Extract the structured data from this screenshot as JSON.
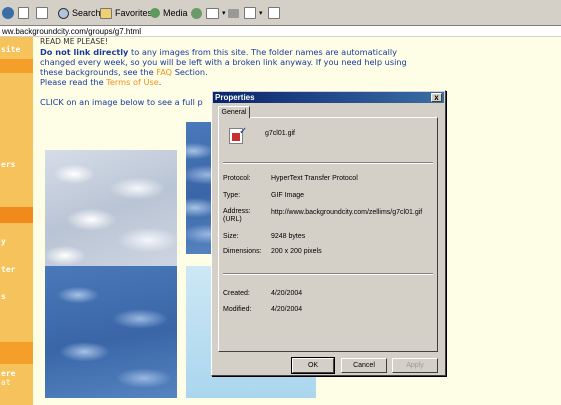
{
  "toolbar": {
    "search_label": "Search",
    "favorites_label": "Favorites",
    "media_label": "Media"
  },
  "address": {
    "url": "ww.backgroundcity.com/groups/g7.html"
  },
  "leftnav": {
    "items": [
      "site",
      "ers",
      "y",
      "ter",
      "s",
      "ere",
      "at"
    ]
  },
  "content": {
    "header_partial": "READ ME PLEASE!",
    "notice_bold": "Do not link directly",
    "notice_rest_1": " to any images from this site. The folder names are automatically changed every week, so you will be left with a broken link anyway. If you need help using these backgrounds, see the ",
    "faq_link": "FAQ",
    "notice_rest_2": " Section.",
    "terms_prefix": "Please read the ",
    "terms_link": "Terms of Use",
    "terms_suffix": ".",
    "click_text": "CLICK on an image below to see a full p"
  },
  "dialog": {
    "title": "Properties",
    "close_glyph": "x",
    "tab_label": "General",
    "filename": "g7cl01.gif",
    "labels": {
      "protocol": "Protocol:",
      "type": "Type:",
      "address": "Address:",
      "address_sub": "(URL)",
      "size": "Size:",
      "dimensions": "Dimensions:",
      "created": "Created:",
      "modified": "Modified:"
    },
    "values": {
      "protocol": "HyperText Transfer Protocol",
      "type": "GIF Image",
      "address": "http://www.backgroundcity.com/zellims/g7cl01.gif",
      "size": "9248 bytes",
      "dimensions": "200  x  200  pixels",
      "created": "4/20/2004",
      "modified": "4/20/2004"
    },
    "buttons": {
      "ok": "OK",
      "cancel": "Cancel",
      "apply": "Apply"
    }
  },
  "colors": {
    "title_bar": "#0a246a",
    "link_text": "#1a3a9e",
    "faq_orange": "#f09020",
    "nav_orange": "#f6c25c",
    "page_bg": "#fefee6",
    "dialog_bg": "#d4d0c8"
  }
}
